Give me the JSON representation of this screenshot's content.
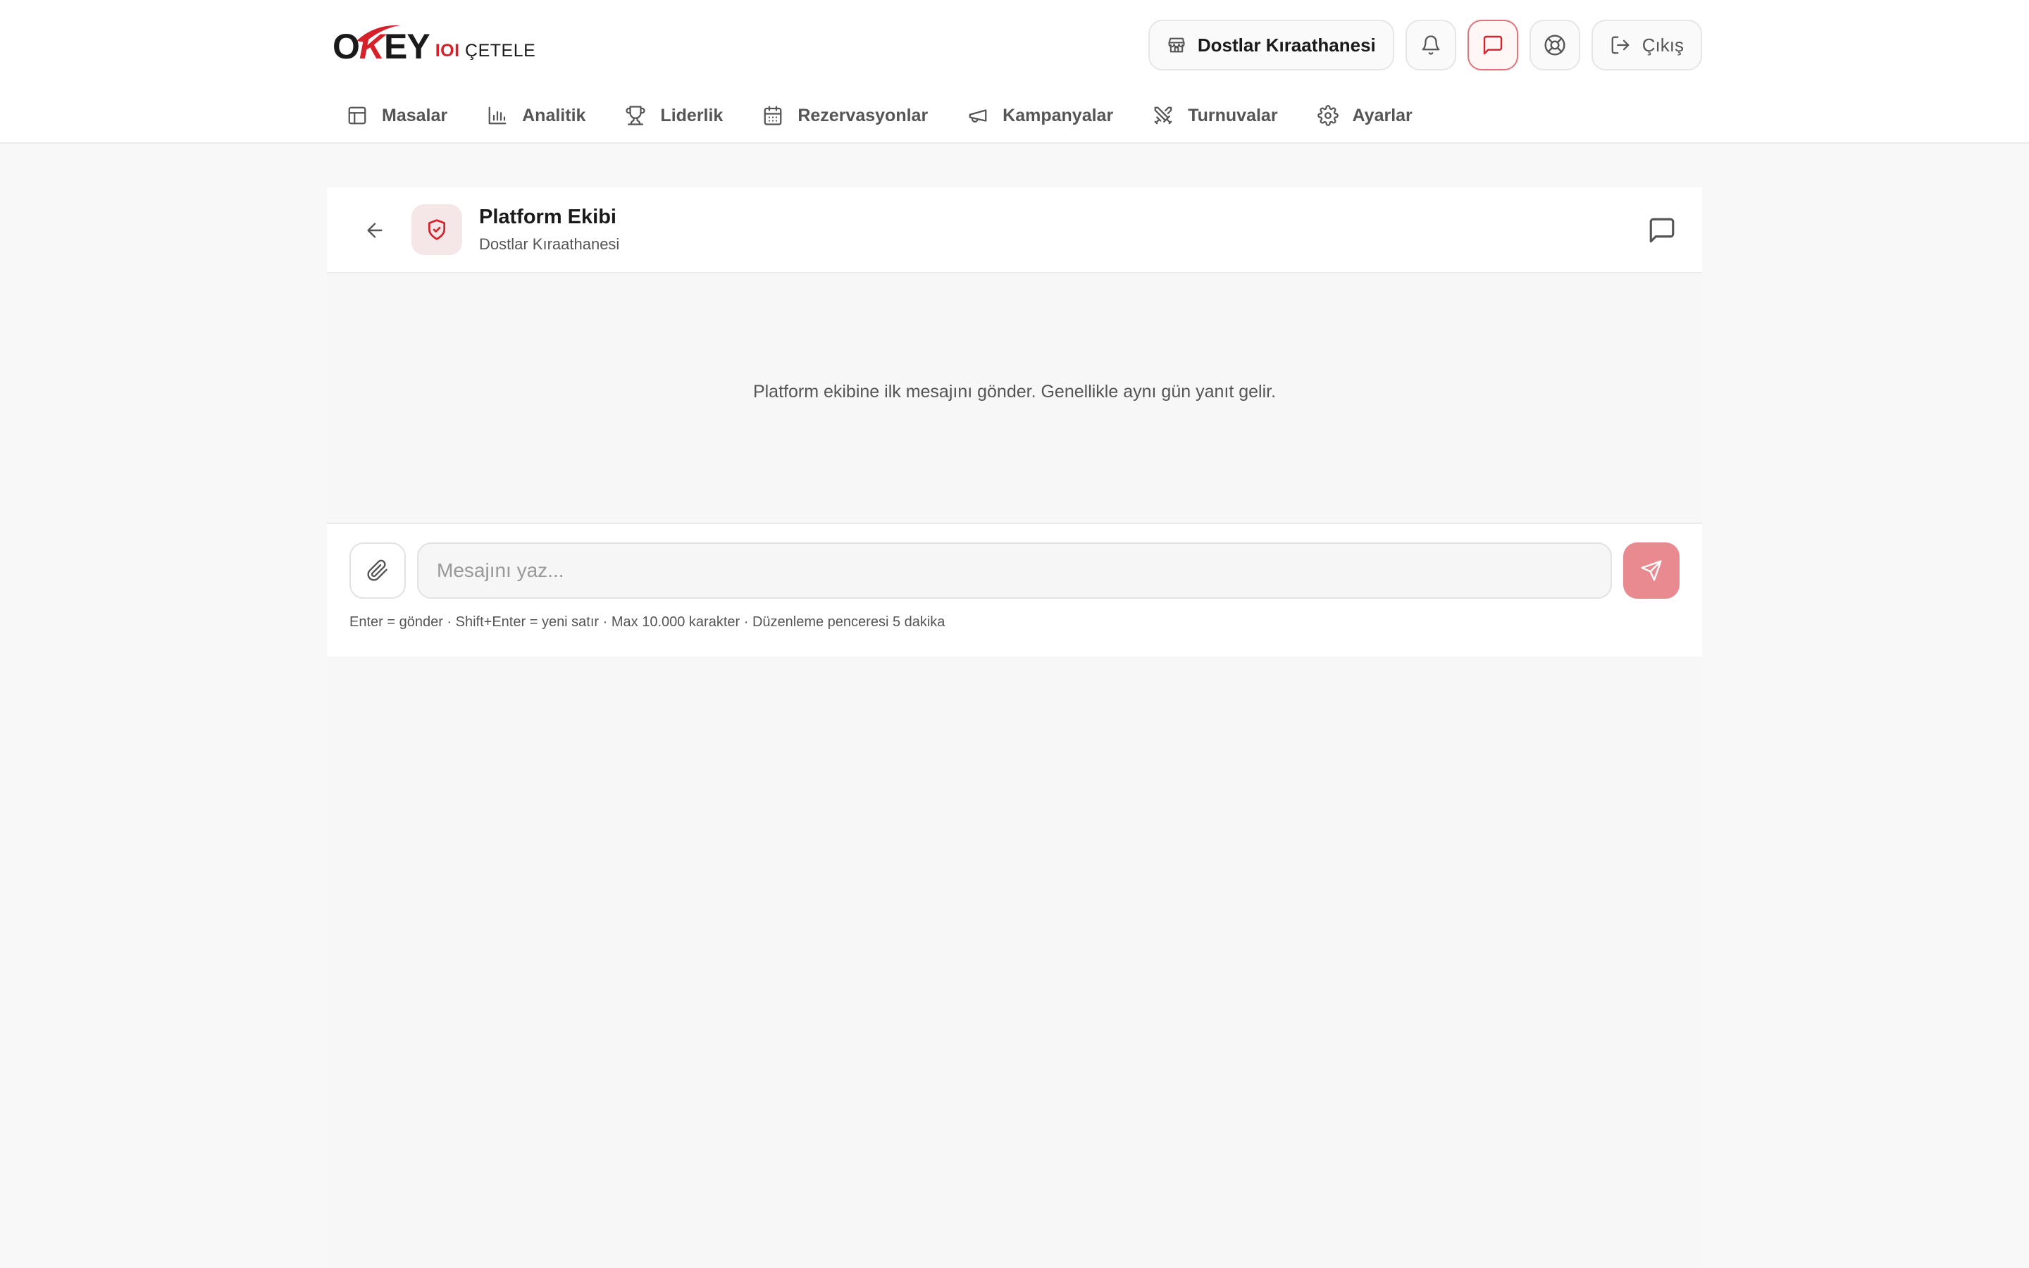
{
  "brand": {
    "logo_main_prefix": "O",
    "logo_main_k": "K",
    "logo_main_suffix": "EY",
    "logo_num": "IOI",
    "logo_sub": "ÇETELE"
  },
  "top_actions": {
    "venue_label": "Dostlar Kıraathanesi",
    "venue_icon": "store-icon",
    "notifications_icon": "bell-icon",
    "messages_icon": "message-square-icon",
    "support_icon": "lifebuoy-icon",
    "logout_label": "Çıkış",
    "logout_icon": "log-out-icon"
  },
  "nav": {
    "items": [
      {
        "label": "Masalar",
        "icon": "table-icon"
      },
      {
        "label": "Analitik",
        "icon": "bar-chart-icon"
      },
      {
        "label": "Liderlik",
        "icon": "trophy-icon"
      },
      {
        "label": "Rezervasyonlar",
        "icon": "calendar-icon"
      },
      {
        "label": "Kampanyalar",
        "icon": "megaphone-icon"
      },
      {
        "label": "Turnuvalar",
        "icon": "swords-icon"
      },
      {
        "label": "Ayarlar",
        "icon": "gear-icon"
      }
    ]
  },
  "chat": {
    "title": "Platform Ekibi",
    "subtitle": "Dostlar Kıraathanesi",
    "empty_message": "Platform ekibine ilk mesajını gönder. Genellikle aynı gün yanıt gelir.",
    "input_placeholder": "Mesajını yaz...",
    "input_value": "",
    "hint": "Enter = gönder · Shift+Enter = yeni satır · Max 10.000 karakter · Düzenleme penceresi 5 dakika"
  },
  "colors": {
    "accent": "#d6202a",
    "send_button": "#e88a8f",
    "background": "#f8f8f8"
  }
}
